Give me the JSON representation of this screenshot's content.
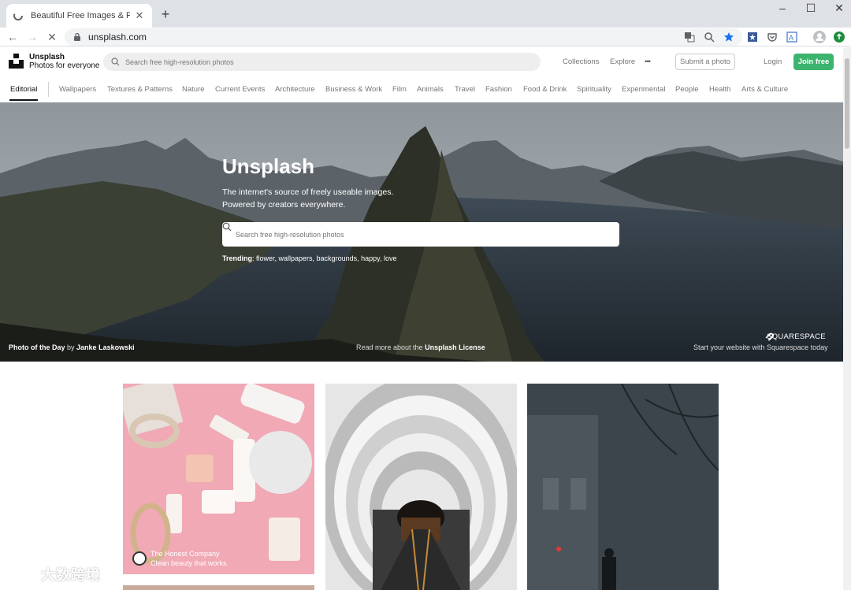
{
  "browser": {
    "tab_title": "Beautiful Free Images & Pictures",
    "url": "unsplash.com"
  },
  "header": {
    "brand_name": "Unsplash",
    "brand_tagline": "Photos for everyone",
    "search_placeholder": "Search free high-resolution photos",
    "collections": "Collections",
    "explore": "Explore",
    "more": "•••",
    "submit": "Submit a photo",
    "login": "Login",
    "join": "Join free"
  },
  "categories": [
    "Editorial",
    "Wallpapers",
    "Textures & Patterns",
    "Nature",
    "Current Events",
    "Architecture",
    "Business & Work",
    "Film",
    "Animals",
    "Travel",
    "Fashion",
    "Food & Drink",
    "Spirituality",
    "Experimental",
    "People",
    "Health",
    "Arts & Culture"
  ],
  "hero": {
    "title": "Unsplash",
    "subtitle_line1": "The internet's source of freely useable images.",
    "subtitle_line2": "Powered by creators everywhere.",
    "search_placeholder": "Search free high-resolution photos",
    "trending_label": "Trending",
    "trending_items": "flower, wallpapers, backgrounds, happy, love",
    "photo_of_day_label": "Photo of the Day",
    "photo_by": "by",
    "photographer": "Janke Laskowski",
    "license_prefix": "Read more about the",
    "license_link": "Unsplash License",
    "sponsor_logo": "SQUARESPACE",
    "sponsor_text": "Start your website with Squarespace today"
  },
  "gallery": {
    "sponsored_name": "The Honest Company",
    "sponsored_tagline": "Clean beauty that works."
  },
  "watermark": "大数跨境",
  "colors": {
    "join_button": "#3cb46e",
    "text_muted": "#767676",
    "bookmark_star": "#1a73e8"
  }
}
